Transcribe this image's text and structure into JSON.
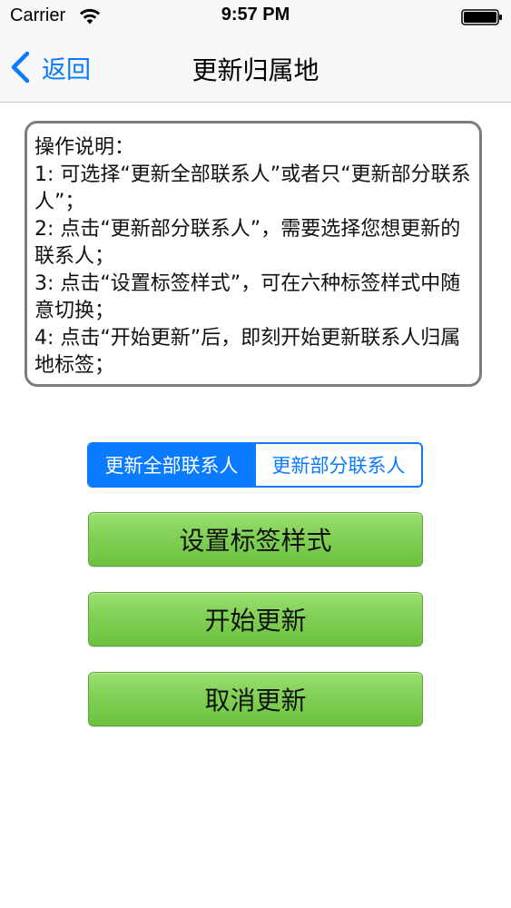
{
  "status_bar": {
    "carrier": "Carrier",
    "time": "9:57 PM",
    "wifi_icon": "wifi-icon",
    "battery_icon": "battery-icon"
  },
  "nav_bar": {
    "back_label": "返回",
    "back_icon": "chevron-left-icon",
    "title": "更新归属地"
  },
  "instructions": {
    "text": "操作说明：\n1: 可选择“更新全部联系人”或者只“更新部分联系人”；\n2: 点击“更新部分联系人”，需要选择您想更新的联系人；\n3: 点击“设置标签样式”，可在六种标签样式中随意切换；\n4: 点击“开始更新”后，即刻开始更新联系人归属地标签；"
  },
  "segmented_control": {
    "segments": [
      {
        "label": "更新全部联系人",
        "selected": true
      },
      {
        "label": "更新部分联系人",
        "selected": false
      }
    ]
  },
  "buttons": {
    "set_label_style": "设置标签样式",
    "start_update": "开始更新",
    "cancel_update": "取消更新"
  },
  "colors": {
    "accent_blue": "#0a7bff",
    "button_green": "#80d055",
    "border_gray": "#7c7c7c"
  }
}
